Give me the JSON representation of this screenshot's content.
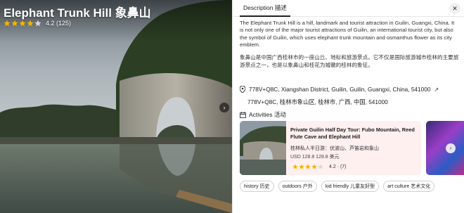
{
  "hero": {
    "title": "Elephant Trunk Hill 象鼻山",
    "rating": 4.2,
    "rating_text": "4.2 (125)",
    "stars_filled": 4,
    "next_icon": "chevron-right-icon"
  },
  "panel": {
    "tab_label": "Description 描述",
    "close_label": "✕",
    "description_en": "The Elephant Trunk Hill is a hill, landmark and tourist attraction in Guilin, Guangxi, China. It is not only one of the major tourist attractions of Guilin, an international tourist city, but also the symbol of Guilin, which uses elephant trunk mountain and osmanthus flower as its city emblem.",
    "description_zh": "象鼻山是中国广西桂林市的一座山丘、地标和旅游景点。它不仅是国际旅游城市桂林的主要旅游景点之一，也是以象鼻山和桂花为城徽的桂林的象征。",
    "address_en": "778V+Q8C, Xiangshan District, Guilin, Guilin, Guangxi, China, 541000",
    "address_zh": "778V+Q8C, 桂林市象山区, 桂林市, 广西, 中国, 541000",
    "activities_header": "Activities 活动"
  },
  "activity_card": {
    "title": "Private Guilin Half Day Tour: Fubo Mountain, Reed Flute Cave and Elephant Hill",
    "subtitle": "桂林私人半日游：伏波山、芦笛岩和象山",
    "price": "USD 128.8 128.8 美元",
    "rating_text": "4.2 · (7)",
    "stars_filled": 4
  },
  "tags": [
    "history 历史",
    "outdoors 户外",
    "kid friendly 儿童友好型",
    "art culture 艺术文化"
  ],
  "colors": {
    "star": "#f5b301",
    "card_bg": "#fff0f0"
  }
}
